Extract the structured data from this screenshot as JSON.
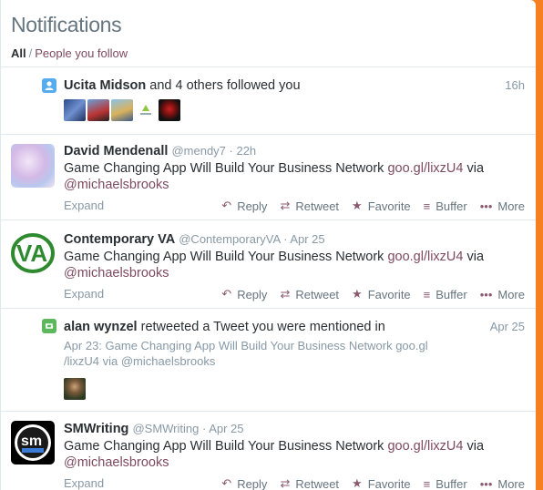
{
  "header": {
    "title": "Notifications",
    "filter_all": "All",
    "filter_sep": "/",
    "filter_follow": "People you follow"
  },
  "follow": {
    "name": "Ucita Midson",
    "rest": "and 4 others followed you",
    "time": "16h"
  },
  "tweets": [
    {
      "name": "David Mendenall",
      "handle": "@mendy7",
      "time": "22h",
      "text": "Game Changing App Will Build Your Business Network",
      "link": "goo.gl/lixzU4",
      "via": "via",
      "mention": "@michaelsbrooks"
    },
    {
      "name": "Contemporary VA",
      "handle": "@ContemporaryVA",
      "time": "Apr 25",
      "text": "Game Changing App Will Build Your Business Network",
      "link": "goo.gl/lixzU4",
      "via": "via",
      "mention": "@michaelsbrooks"
    },
    {
      "name": "SMWriting",
      "handle": "@SMWriting",
      "time": "Apr 25",
      "text": "Game Changing App Will Build Your Business Network",
      "link": "goo.gl/lixzU4",
      "via": "via",
      "mention": "@michaelsbrooks"
    }
  ],
  "retweet": {
    "name": "alan wynzel",
    "rest": "retweeted a Tweet you were mentioned in",
    "time": "Apr 25",
    "quote1": "Apr 23: Game Changing App Will Build Your Business Network goo.gl",
    "quote2": "/lixzU4 via @michaelsbrooks"
  },
  "actions": {
    "expand": "Expand",
    "reply": "Reply",
    "retweet": "Retweet",
    "favorite": "Favorite",
    "buffer": "Buffer",
    "more": "More"
  },
  "icons": {
    "follow": "person-icon",
    "retweet": "retweet-icon",
    "reply": "reply-arrow-icon",
    "favorite": "star-icon",
    "buffer": "stack-icon",
    "more": "dots-icon"
  },
  "colors": {
    "accent": "#7e4a5e",
    "background": "#f6801f",
    "follow_icon": "#55acee",
    "retweet_icon": "#5db75d"
  }
}
